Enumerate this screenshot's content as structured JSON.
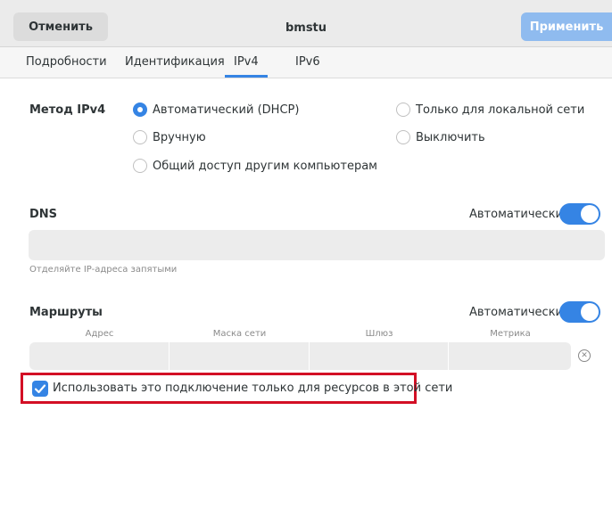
{
  "header": {
    "cancel_label": "Отменить",
    "title": "bmstu",
    "apply_label": "Применить"
  },
  "tabs": [
    {
      "label": "Подробности",
      "active": false
    },
    {
      "label": "Идентификация",
      "active": false
    },
    {
      "label": "IPv4",
      "active": true
    },
    {
      "label": "IPv6",
      "active": false
    }
  ],
  "ipv4_method": {
    "label": "Метод IPv4",
    "options": [
      {
        "label": "Автоматический (DHCP)",
        "checked": true
      },
      {
        "label": "Только для локальной сети",
        "checked": false
      },
      {
        "label": "Вручную",
        "checked": false
      },
      {
        "label": "Выключить",
        "checked": false
      },
      {
        "label": "Общий доступ другим компьютерам",
        "checked": false
      }
    ]
  },
  "dns": {
    "label": "DNS",
    "auto_label": "Автоматически",
    "auto_on": true,
    "value": "",
    "hint": "Отделяйте IP-адреса запятыми"
  },
  "routes": {
    "label": "Маршруты",
    "auto_label": "Автоматически",
    "auto_on": true,
    "columns": [
      "Адрес",
      "Маска сети",
      "Шлюз",
      "Метрика"
    ]
  },
  "only_local_resources": {
    "label": "Использовать это подключение только для ресурсов в этой сети",
    "checked": true
  },
  "colors": {
    "accent": "#3584e4",
    "apply_disabled": "#8fbbef",
    "highlight_border": "#d30f25"
  },
  "icons": {
    "checkmark": "check-icon",
    "clear": "clear-circle-icon"
  }
}
